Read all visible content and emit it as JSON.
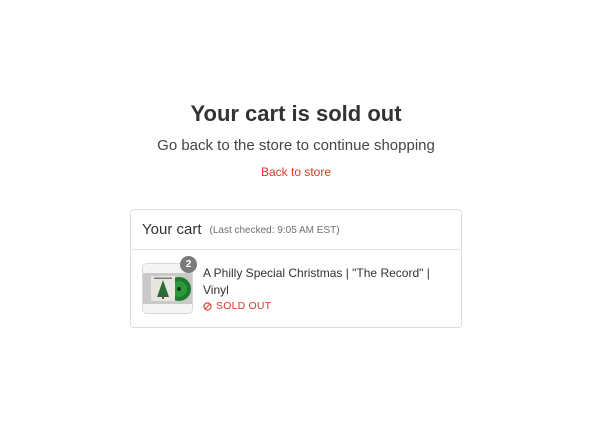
{
  "message": {
    "headline": "Your cart is sold out",
    "subline": "Go back to the store to continue shopping",
    "back_link": "Back to store"
  },
  "cart": {
    "title": "Your cart",
    "last_checked": "(Last checked: 9:05 AM EST)",
    "items": [
      {
        "name": "A Philly Special Christmas | \"The Record\" | Vinyl",
        "quantity": "2",
        "status": "SOLD OUT",
        "status_icon": "no-entry-icon"
      }
    ]
  },
  "colors": {
    "accent": "#d83a27",
    "text": "#333333",
    "muted": "#6f6f6f",
    "badge": "#7a7a7a",
    "border": "#dcdcdc"
  }
}
